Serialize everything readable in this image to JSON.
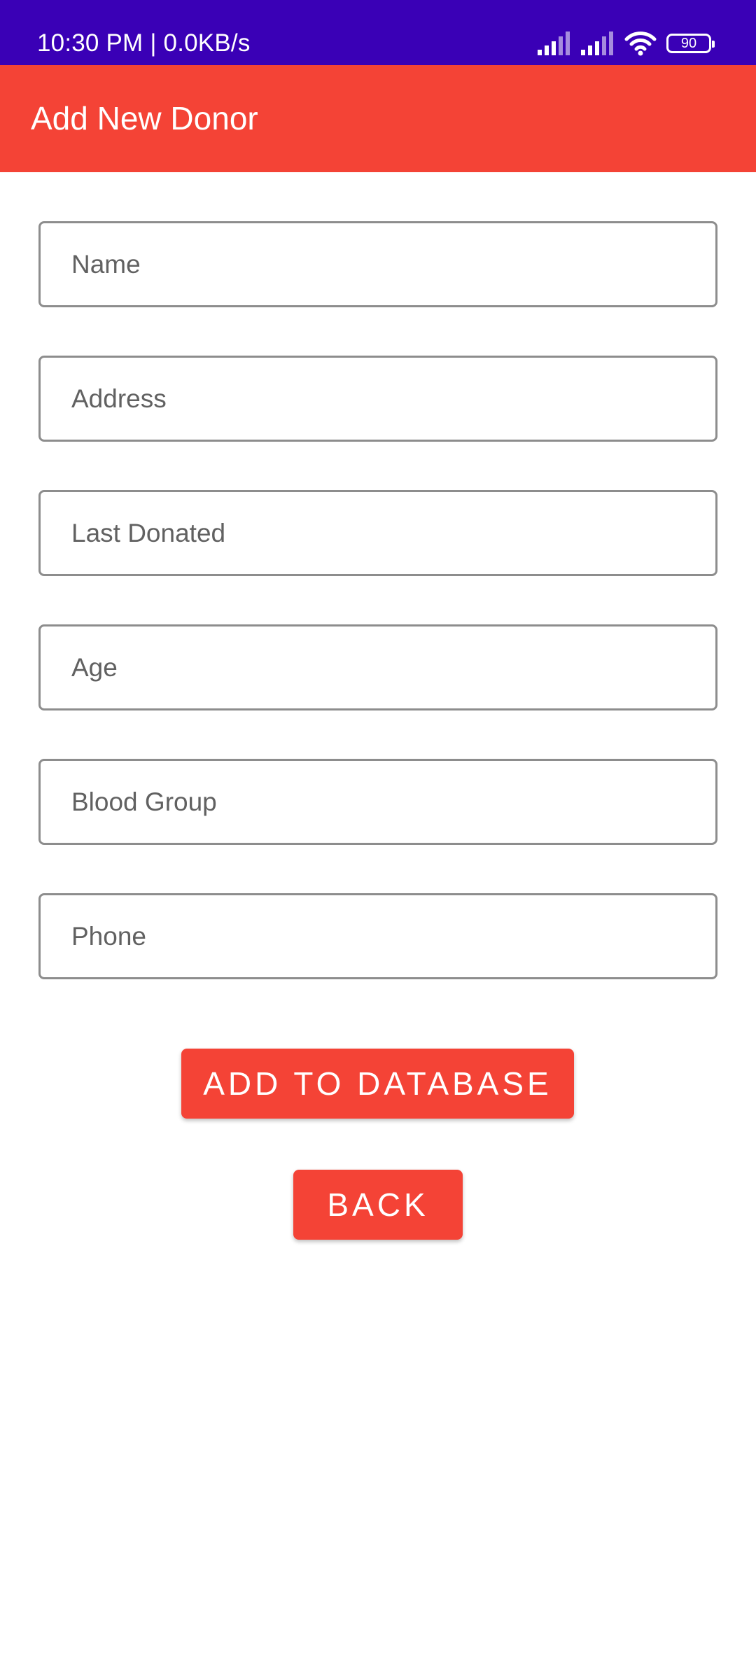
{
  "status_bar": {
    "time_speed": "10:30 PM | 0.0KB/s",
    "battery_level": "90",
    "icons": [
      "signal-icon",
      "signal-icon",
      "wifi-icon",
      "battery-icon"
    ],
    "background_color": "#3a00b6"
  },
  "app_bar": {
    "title": "Add New Donor",
    "background_color": "#f44336"
  },
  "form": {
    "fields": [
      {
        "placeholder": "Name",
        "value": ""
      },
      {
        "placeholder": "Address",
        "value": ""
      },
      {
        "placeholder": "Last Donated",
        "value": ""
      },
      {
        "placeholder": "Age",
        "value": ""
      },
      {
        "placeholder": "Blood Group",
        "value": ""
      },
      {
        "placeholder": "Phone",
        "value": ""
      }
    ]
  },
  "buttons": {
    "add_label": "ADD TO DATABASE",
    "back_label": "BACK",
    "color": "#f44336"
  }
}
